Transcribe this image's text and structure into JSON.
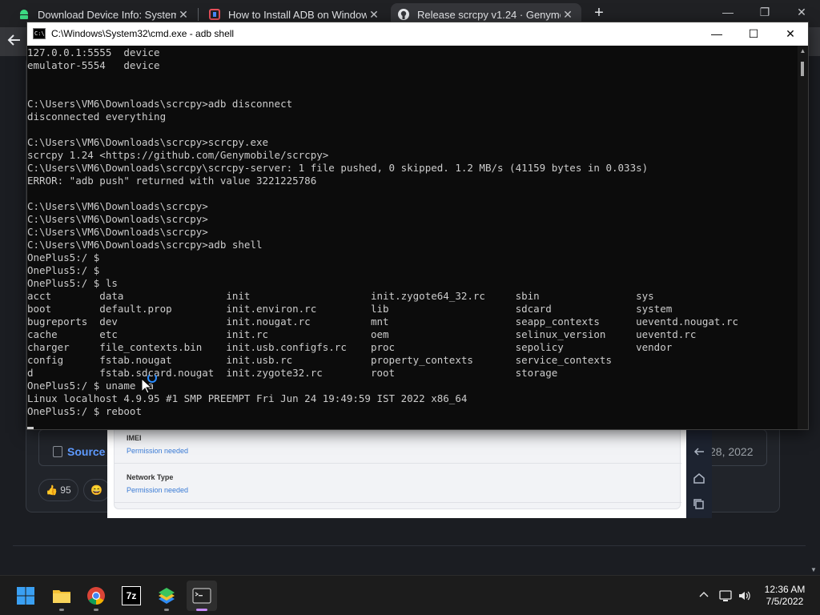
{
  "browser": {
    "tabs": [
      {
        "label": "Download Device Info: System &",
        "icon": "android-icon",
        "active": false
      },
      {
        "label": "How to Install ADB on Windows,",
        "icon": "site-icon",
        "active": false
      },
      {
        "label": "Release scrcpy v1.24 · Genymobil",
        "icon": "github-icon",
        "active": true
      }
    ],
    "new_tab": "+",
    "window_controls": {
      "minimize": "—",
      "maximize": "❐",
      "close": "✕"
    }
  },
  "page": {
    "source_label": "Source",
    "date": "28, 2022",
    "reactions": [
      {
        "emoji": "👍",
        "count": "95"
      },
      {
        "emoji": "😄",
        "count": ""
      }
    ]
  },
  "emulator": {
    "fields": [
      {
        "name": "IMEI",
        "value": "Permission needed"
      },
      {
        "name": "Network Type",
        "value": "Permission needed"
      }
    ],
    "side_buttons": [
      "back-icon",
      "home-icon",
      "recents-icon"
    ]
  },
  "cmd": {
    "title": "C:\\Windows\\System32\\cmd.exe - adb  shell",
    "controls": {
      "minimize": "—",
      "maximize": "☐",
      "close": "✕"
    },
    "lines": [
      "127.0.0.1:5555  device",
      "emulator-5554   device",
      "",
      "",
      "C:\\Users\\VM6\\Downloads\\scrcpy>adb disconnect",
      "disconnected everything",
      "",
      "C:\\Users\\VM6\\Downloads\\scrcpy>scrcpy.exe",
      "scrcpy 1.24 <https://github.com/Genymobile/scrcpy>",
      "C:\\Users\\VM6\\Downloads\\scrcpy\\scrcpy-server: 1 file pushed, 0 skipped. 1.2 MB/s (41159 bytes in 0.033s)",
      "ERROR: \"adb push\" returned with value 3221225786",
      "",
      "C:\\Users\\VM6\\Downloads\\scrcpy>",
      "C:\\Users\\VM6\\Downloads\\scrcpy>",
      "C:\\Users\\VM6\\Downloads\\scrcpy>",
      "C:\\Users\\VM6\\Downloads\\scrcpy>adb shell",
      "OnePlus5:/ $",
      "OnePlus5:/ $",
      "OnePlus5:/ $ ls",
      "acct        data                 init                    init.zygote64_32.rc     sbin                sys",
      "boot        default.prop         init.environ.rc         lib                     sdcard              system",
      "bugreports  dev                  init.nougat.rc          mnt                     seapp_contexts      ueventd.nougat.rc",
      "cache       etc                  init.rc                 oem                     selinux_version     ueventd.rc",
      "charger     file_contexts.bin    init.usb.configfs.rc    proc                    sepolicy            vendor",
      "config      fstab.nougat         init.usb.rc             property_contexts       service_contexts",
      "d           fstab.sdcard.nougat  init.zygote32.rc        root                    storage",
      "OnePlus5:/ $ uname -a",
      "Linux localhost 4.9.95 #1 SMP PREEMPT Fri Jun 24 19:49:59 IST 2022 x86_64",
      "OnePlus5:/ $ reboot"
    ]
  },
  "taskbar": {
    "apps": [
      {
        "name": "start",
        "icon": "windows-start-icon"
      },
      {
        "name": "file-explorer",
        "icon": "folder-icon"
      },
      {
        "name": "chrome",
        "icon": "chrome-icon"
      },
      {
        "name": "7zip",
        "icon": "7zip-icon",
        "text": "7z"
      },
      {
        "name": "bluestacks",
        "icon": "bluestacks-icon"
      },
      {
        "name": "terminal",
        "icon": "terminal-icon"
      }
    ],
    "tray": {
      "chevron": "^",
      "time": "12:36 AM",
      "date": "7/5/2022"
    }
  },
  "colors": {
    "console_bg": "#0c0c0c",
    "console_text": "#cccccc",
    "link_blue": "#5f9bff",
    "emulator_hint": "#3a7bd5",
    "terminal_active_dot": "#c58af9"
  }
}
